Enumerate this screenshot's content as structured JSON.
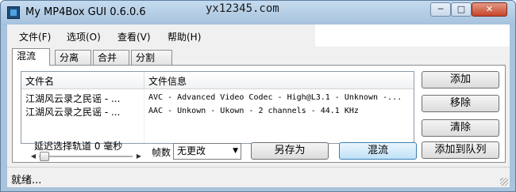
{
  "window": {
    "title": "My MP4Box GUI 0.6.0.6",
    "watermark": "yx12345.com",
    "controls": {
      "minimize": "─",
      "maximize": "□",
      "close": "✕"
    }
  },
  "menu": {
    "file": "文件(F)",
    "options": "选项(O)",
    "view": "查看(V)",
    "help": "帮助(H)"
  },
  "tabs": [
    {
      "label": "混流",
      "active": true
    },
    {
      "label": "分离"
    },
    {
      "label": "合并"
    },
    {
      "label": "分割"
    }
  ],
  "list": {
    "columns": {
      "name": "文件名",
      "info": "文件信息"
    },
    "rows": [
      {
        "name": "江湖风云录之民谣 - ...",
        "info": "AVC - Advanced Video Codec - High@L3.1 - Unknown -..."
      },
      {
        "name": "江湖风云录之民谣 - ...",
        "info": "AAC - Unkown - Ukown - 2 channels - 44.1 KHz"
      }
    ]
  },
  "side_buttons": {
    "add": "添加",
    "remove": "移除",
    "clear": "清除"
  },
  "delay": {
    "label": "延迟选择轨道 0 毫秒"
  },
  "fps": {
    "label": "帧数",
    "value": "无更改"
  },
  "actions": {
    "save_as": "另存为",
    "mux": "混流",
    "add_to_queue": "添加到队列"
  },
  "status": {
    "text": "就绪..."
  }
}
